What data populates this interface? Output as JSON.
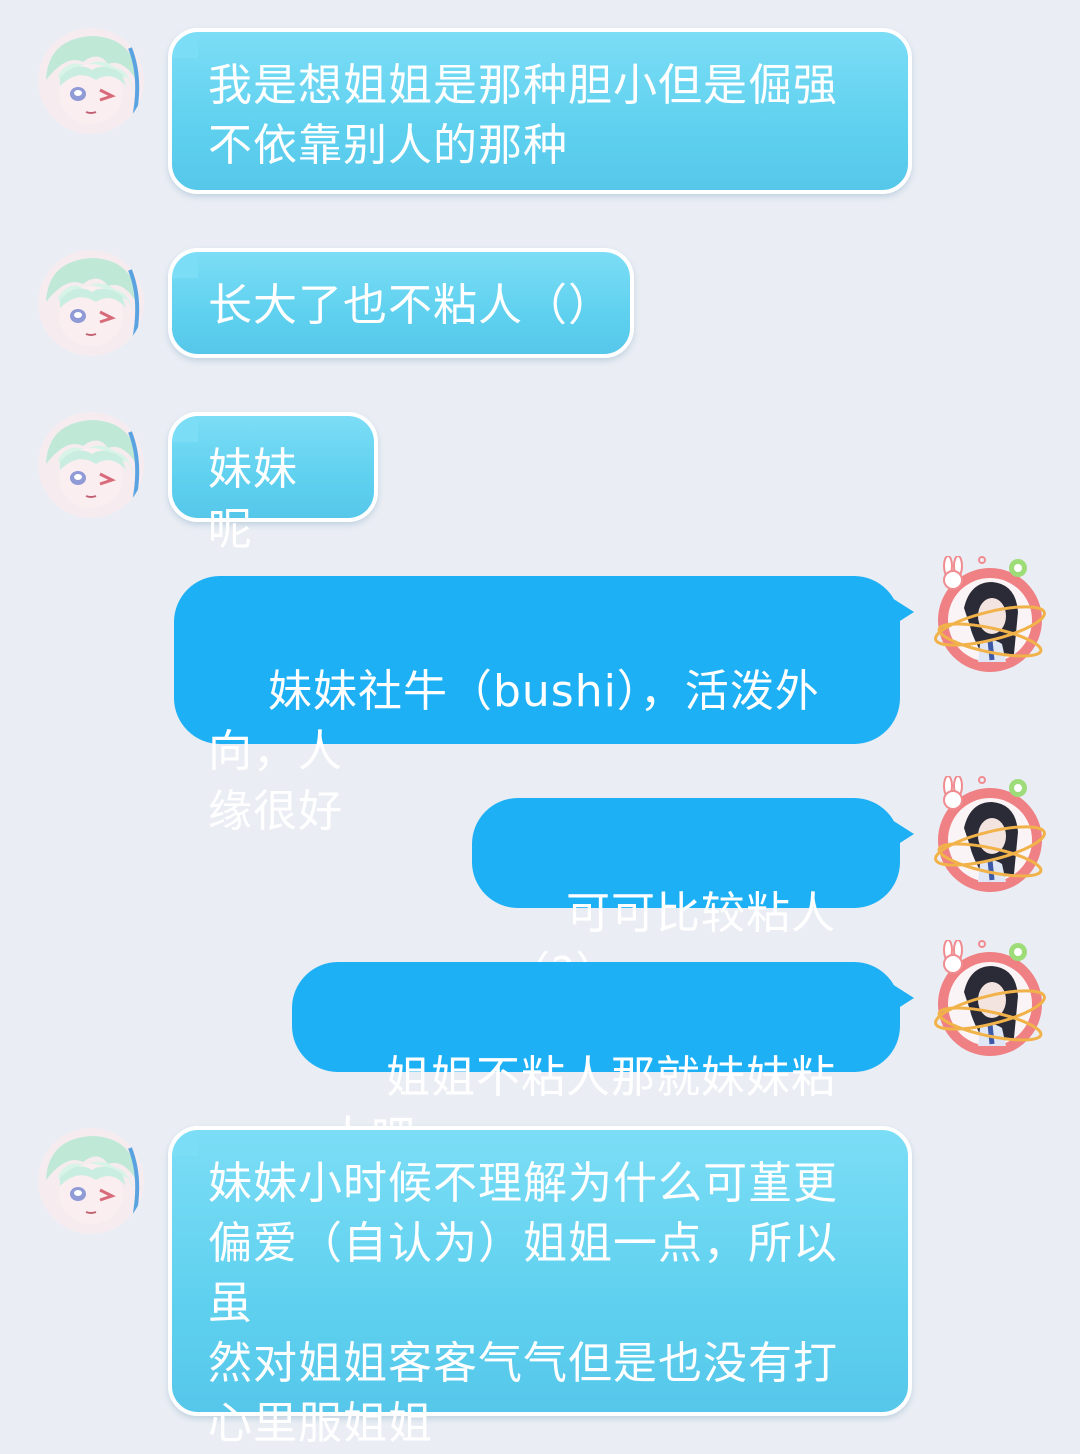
{
  "messages": [
    {
      "side": "in",
      "text": "我是想姐姐是那种胆小但是倔强\n不依靠别人的那种",
      "avatar": "green-hair-anime-avatar"
    },
    {
      "side": "in",
      "text": "长大了也不粘人（）",
      "avatar": "green-hair-anime-avatar"
    },
    {
      "side": "in",
      "text": "妹妹呢",
      "avatar": "green-hair-anime-avatar"
    },
    {
      "side": "out",
      "text": "妹妹社牛（bushi），活泼外向，人\n缘很好",
      "avatar": "dark-hair-girl-avatar"
    },
    {
      "side": "out",
      "text": "可可比较粘人（?）",
      "avatar": "dark-hair-girl-avatar"
    },
    {
      "side": "out",
      "text": "姐姐不粘人那就妹妹粘人吧",
      "avatar": "dark-hair-girl-avatar"
    },
    {
      "side": "in",
      "text": "妹妹小时候不理解为什么可堇更\n偏爱（自认为）姐姐一点，所以虽\n然对姐姐客客气气但是也没有打\n心里服姐姐",
      "avatar": "green-hair-anime-avatar"
    }
  ],
  "colors": {
    "background": "#eaedf4",
    "incoming_bubble": "#5fd1ef",
    "outgoing_bubble": "#1eb0f5",
    "bubble_text": "#ffffff"
  }
}
